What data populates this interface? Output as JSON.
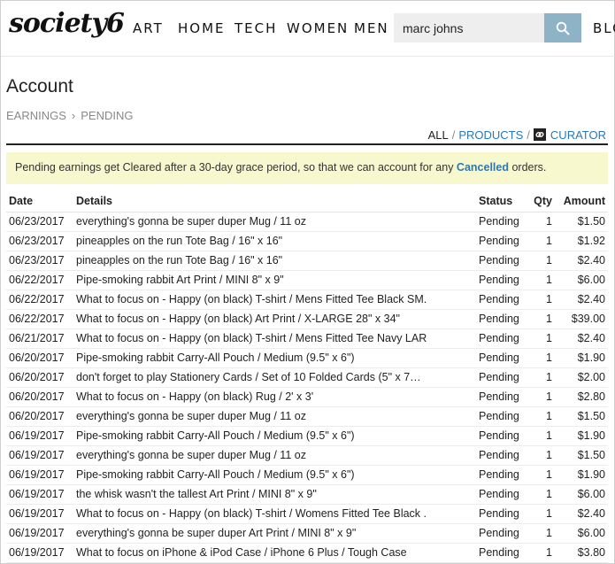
{
  "header": {
    "logo": "society6",
    "nav": [
      "ART",
      "HOME",
      "TECH",
      "WOMEN",
      "MEN",
      "BLO"
    ],
    "search_value": "marc johns"
  },
  "page": {
    "title": "Account",
    "breadcrumb": [
      "EARNINGS",
      "PENDING"
    ],
    "filters": {
      "all": "ALL",
      "products": "PRODUCTS",
      "curator": "CURATOR"
    },
    "notice": {
      "before": "Pending earnings get Cleared after a 30-day grace period, so that we can account for any ",
      "highlight": "Cancelled",
      "after": " orders."
    }
  },
  "table": {
    "headers": [
      "Date",
      "Details",
      "Status",
      "Qty",
      "Amount"
    ],
    "rows": [
      [
        "06/23/2017",
        "everything's gonna be super duper Mug / 11 oz",
        "Pending",
        "1",
        "$1.50"
      ],
      [
        "06/23/2017",
        "pineapples on the run Tote Bag / 16\" x 16\"",
        "Pending",
        "1",
        "$1.92"
      ],
      [
        "06/23/2017",
        "pineapples on the run Tote Bag / 16\" x 16\"",
        "Pending",
        "1",
        "$2.40"
      ],
      [
        "06/22/2017",
        "Pipe-smoking rabbit Art Print / MINI 8\" x 9\"",
        "Pending",
        "1",
        "$6.00"
      ],
      [
        "06/22/2017",
        "What to focus on - Happy (on black) T-shirt / Mens Fitted Tee Black SM.",
        "Pending",
        "1",
        "$2.40"
      ],
      [
        "06/22/2017",
        "What to focus on - Happy (on black) Art Print / X-LARGE 28\" x 34\"",
        "Pending",
        "1",
        "$39.00"
      ],
      [
        "06/21/2017",
        "What to focus on - Happy (on black) T-shirt / Mens Fitted Tee Navy LAR",
        "Pending",
        "1",
        "$2.40"
      ],
      [
        "06/20/2017",
        "Pipe-smoking rabbit Carry-All Pouch / Medium (9.5\" x 6\")",
        "Pending",
        "1",
        "$1.90"
      ],
      [
        "06/20/2017",
        "don't forget to play Stationery Cards / Set of 10 Folded Cards (5\" x 7…",
        "Pending",
        "1",
        "$2.00"
      ],
      [
        "06/20/2017",
        "What to focus on - Happy (on black) Rug / 2' x 3'",
        "Pending",
        "1",
        "$2.80"
      ],
      [
        "06/20/2017",
        "everything's gonna be super duper Mug / 11 oz",
        "Pending",
        "1",
        "$1.50"
      ],
      [
        "06/19/2017",
        "Pipe-smoking rabbit Carry-All Pouch / Medium (9.5\" x 6\")",
        "Pending",
        "1",
        "$1.90"
      ],
      [
        "06/19/2017",
        "everything's gonna be super duper Mug / 11 oz",
        "Pending",
        "1",
        "$1.50"
      ],
      [
        "06/19/2017",
        "Pipe-smoking rabbit Carry-All Pouch / Medium (9.5\" x 6\")",
        "Pending",
        "1",
        "$1.90"
      ],
      [
        "06/19/2017",
        "the whisk wasn't the tallest Art Print / MINI 8\" x 9\"",
        "Pending",
        "1",
        "$6.00"
      ],
      [
        "06/19/2017",
        "What to focus on - Happy (on black) T-shirt / Womens Fitted Tee Black .",
        "Pending",
        "1",
        "$2.40"
      ],
      [
        "06/19/2017",
        "everything's gonna be super duper Art Print / MINI 8\" x 9\"",
        "Pending",
        "1",
        "$6.00"
      ],
      [
        "06/19/2017",
        "What to focus on iPhone & iPod Case / iPhone 6 Plus / Tough Case",
        "Pending",
        "1",
        "$3.80"
      ]
    ]
  },
  "colors": {
    "link": "#2a78b6",
    "notice_bg": "#f8f8cf",
    "search_button": "#8fb3c6"
  }
}
